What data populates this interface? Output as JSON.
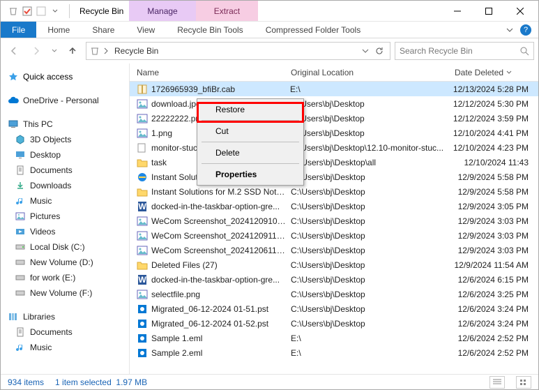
{
  "title": "Recycle Bin",
  "contextual_tabs": [
    {
      "group": "Manage",
      "tool": "Recycle Bin Tools"
    },
    {
      "group": "Extract",
      "tool": "Compressed Folder Tools"
    }
  ],
  "ribbon": {
    "file": "File",
    "tabs": [
      "Home",
      "Share",
      "View"
    ]
  },
  "address": {
    "location": "Recycle Bin"
  },
  "search": {
    "placeholder": "Search Recycle Bin"
  },
  "navpane": {
    "quick_access": "Quick access",
    "onedrive": "OneDrive - Personal",
    "this_pc": "This PC",
    "pc_items": [
      "3D Objects",
      "Desktop",
      "Documents",
      "Downloads",
      "Music",
      "Pictures",
      "Videos",
      "Local Disk (C:)",
      "New Volume (D:)",
      "for work (E:)",
      "New Volume (F:)"
    ],
    "libraries": "Libraries",
    "lib_items": [
      "Documents",
      "Music"
    ]
  },
  "columns": {
    "name": "Name",
    "location": "Original Location",
    "date": "Date Deleted"
  },
  "files": [
    {
      "name": "1726965939_bfiBr.cab",
      "loc": "E:\\",
      "date": "12/13/2024 5:28 PM",
      "icon": "cab",
      "selected": true
    },
    {
      "name": "download.jpg",
      "loc": "C:\\Users\\bj\\Desktop",
      "date": "12/12/2024 5:30 PM",
      "icon": "img"
    },
    {
      "name": "22222222.png",
      "loc": "C:\\Users\\bj\\Desktop",
      "date": "12/12/2024 3:59 PM",
      "icon": "img"
    },
    {
      "name": "1.png",
      "loc": "C:\\Users\\bj\\Desktop",
      "date": "12/10/2024 4:41 PM",
      "icon": "img"
    },
    {
      "name": "monitor-stuck-in...",
      "loc": "C:\\Users\\bj\\Desktop\\12.10-monitor-stuc...",
      "date": "12/10/2024 4:23 PM",
      "icon": "doc"
    },
    {
      "name": "task",
      "loc": "C:\\Users\\bj\\Desktop\\all",
      "date": "12/10/2024 11:43",
      "icon": "folder"
    },
    {
      "name": "Instant Solutions for M.2 SSD Not S...",
      "loc": "C:\\Users\\bj\\Desktop",
      "date": "12/9/2024 5:58 PM",
      "icon": "ie"
    },
    {
      "name": "Instant Solutions for M.2 SSD Not S...",
      "loc": "C:\\Users\\bj\\Desktop",
      "date": "12/9/2024 5:58 PM",
      "icon": "folder"
    },
    {
      "name": "docked-in-the-taskbar-option-gre...",
      "loc": "C:\\Users\\bj\\Desktop",
      "date": "12/9/2024 3:05 PM",
      "icon": "word"
    },
    {
      "name": "WeCom Screenshot_202412091059...",
      "loc": "C:\\Users\\bj\\Desktop",
      "date": "12/9/2024 3:03 PM",
      "icon": "img"
    },
    {
      "name": "WeCom Screenshot_202412091100...",
      "loc": "C:\\Users\\bj\\Desktop",
      "date": "12/9/2024 3:03 PM",
      "icon": "img"
    },
    {
      "name": "WeCom Screenshot_202412061139...",
      "loc": "C:\\Users\\bj\\Desktop",
      "date": "12/9/2024 3:03 PM",
      "icon": "img"
    },
    {
      "name": "Deleted Files (27)",
      "loc": "C:\\Users\\bj\\Desktop",
      "date": "12/9/2024 11:54 AM",
      "icon": "folder"
    },
    {
      "name": "docked-in-the-taskbar-option-gre...",
      "loc": "C:\\Users\\bj\\Desktop",
      "date": "12/6/2024 6:15 PM",
      "icon": "word"
    },
    {
      "name": "selectfile.png",
      "loc": "C:\\Users\\bj\\Desktop",
      "date": "12/6/2024 3:25 PM",
      "icon": "img"
    },
    {
      "name": "Migrated_06-12-2024 01-51.pst",
      "loc": "C:\\Users\\bj\\Desktop",
      "date": "12/6/2024 3:24 PM",
      "icon": "outlook"
    },
    {
      "name": "Migrated_06-12-2024 01-52.pst",
      "loc": "C:\\Users\\bj\\Desktop",
      "date": "12/6/2024 3:24 PM",
      "icon": "outlook"
    },
    {
      "name": "Sample 1.eml",
      "loc": "E:\\",
      "date": "12/6/2024 2:52 PM",
      "icon": "outlook"
    },
    {
      "name": "Sample 2.eml",
      "loc": "E:\\",
      "date": "12/6/2024 2:52 PM",
      "icon": "outlook"
    }
  ],
  "context_menu": {
    "restore": "Restore",
    "cut": "Cut",
    "delete": "Delete",
    "properties": "Properties"
  },
  "status": {
    "count": "934 items",
    "selected": "1 item selected",
    "size": "1.97 MB"
  }
}
